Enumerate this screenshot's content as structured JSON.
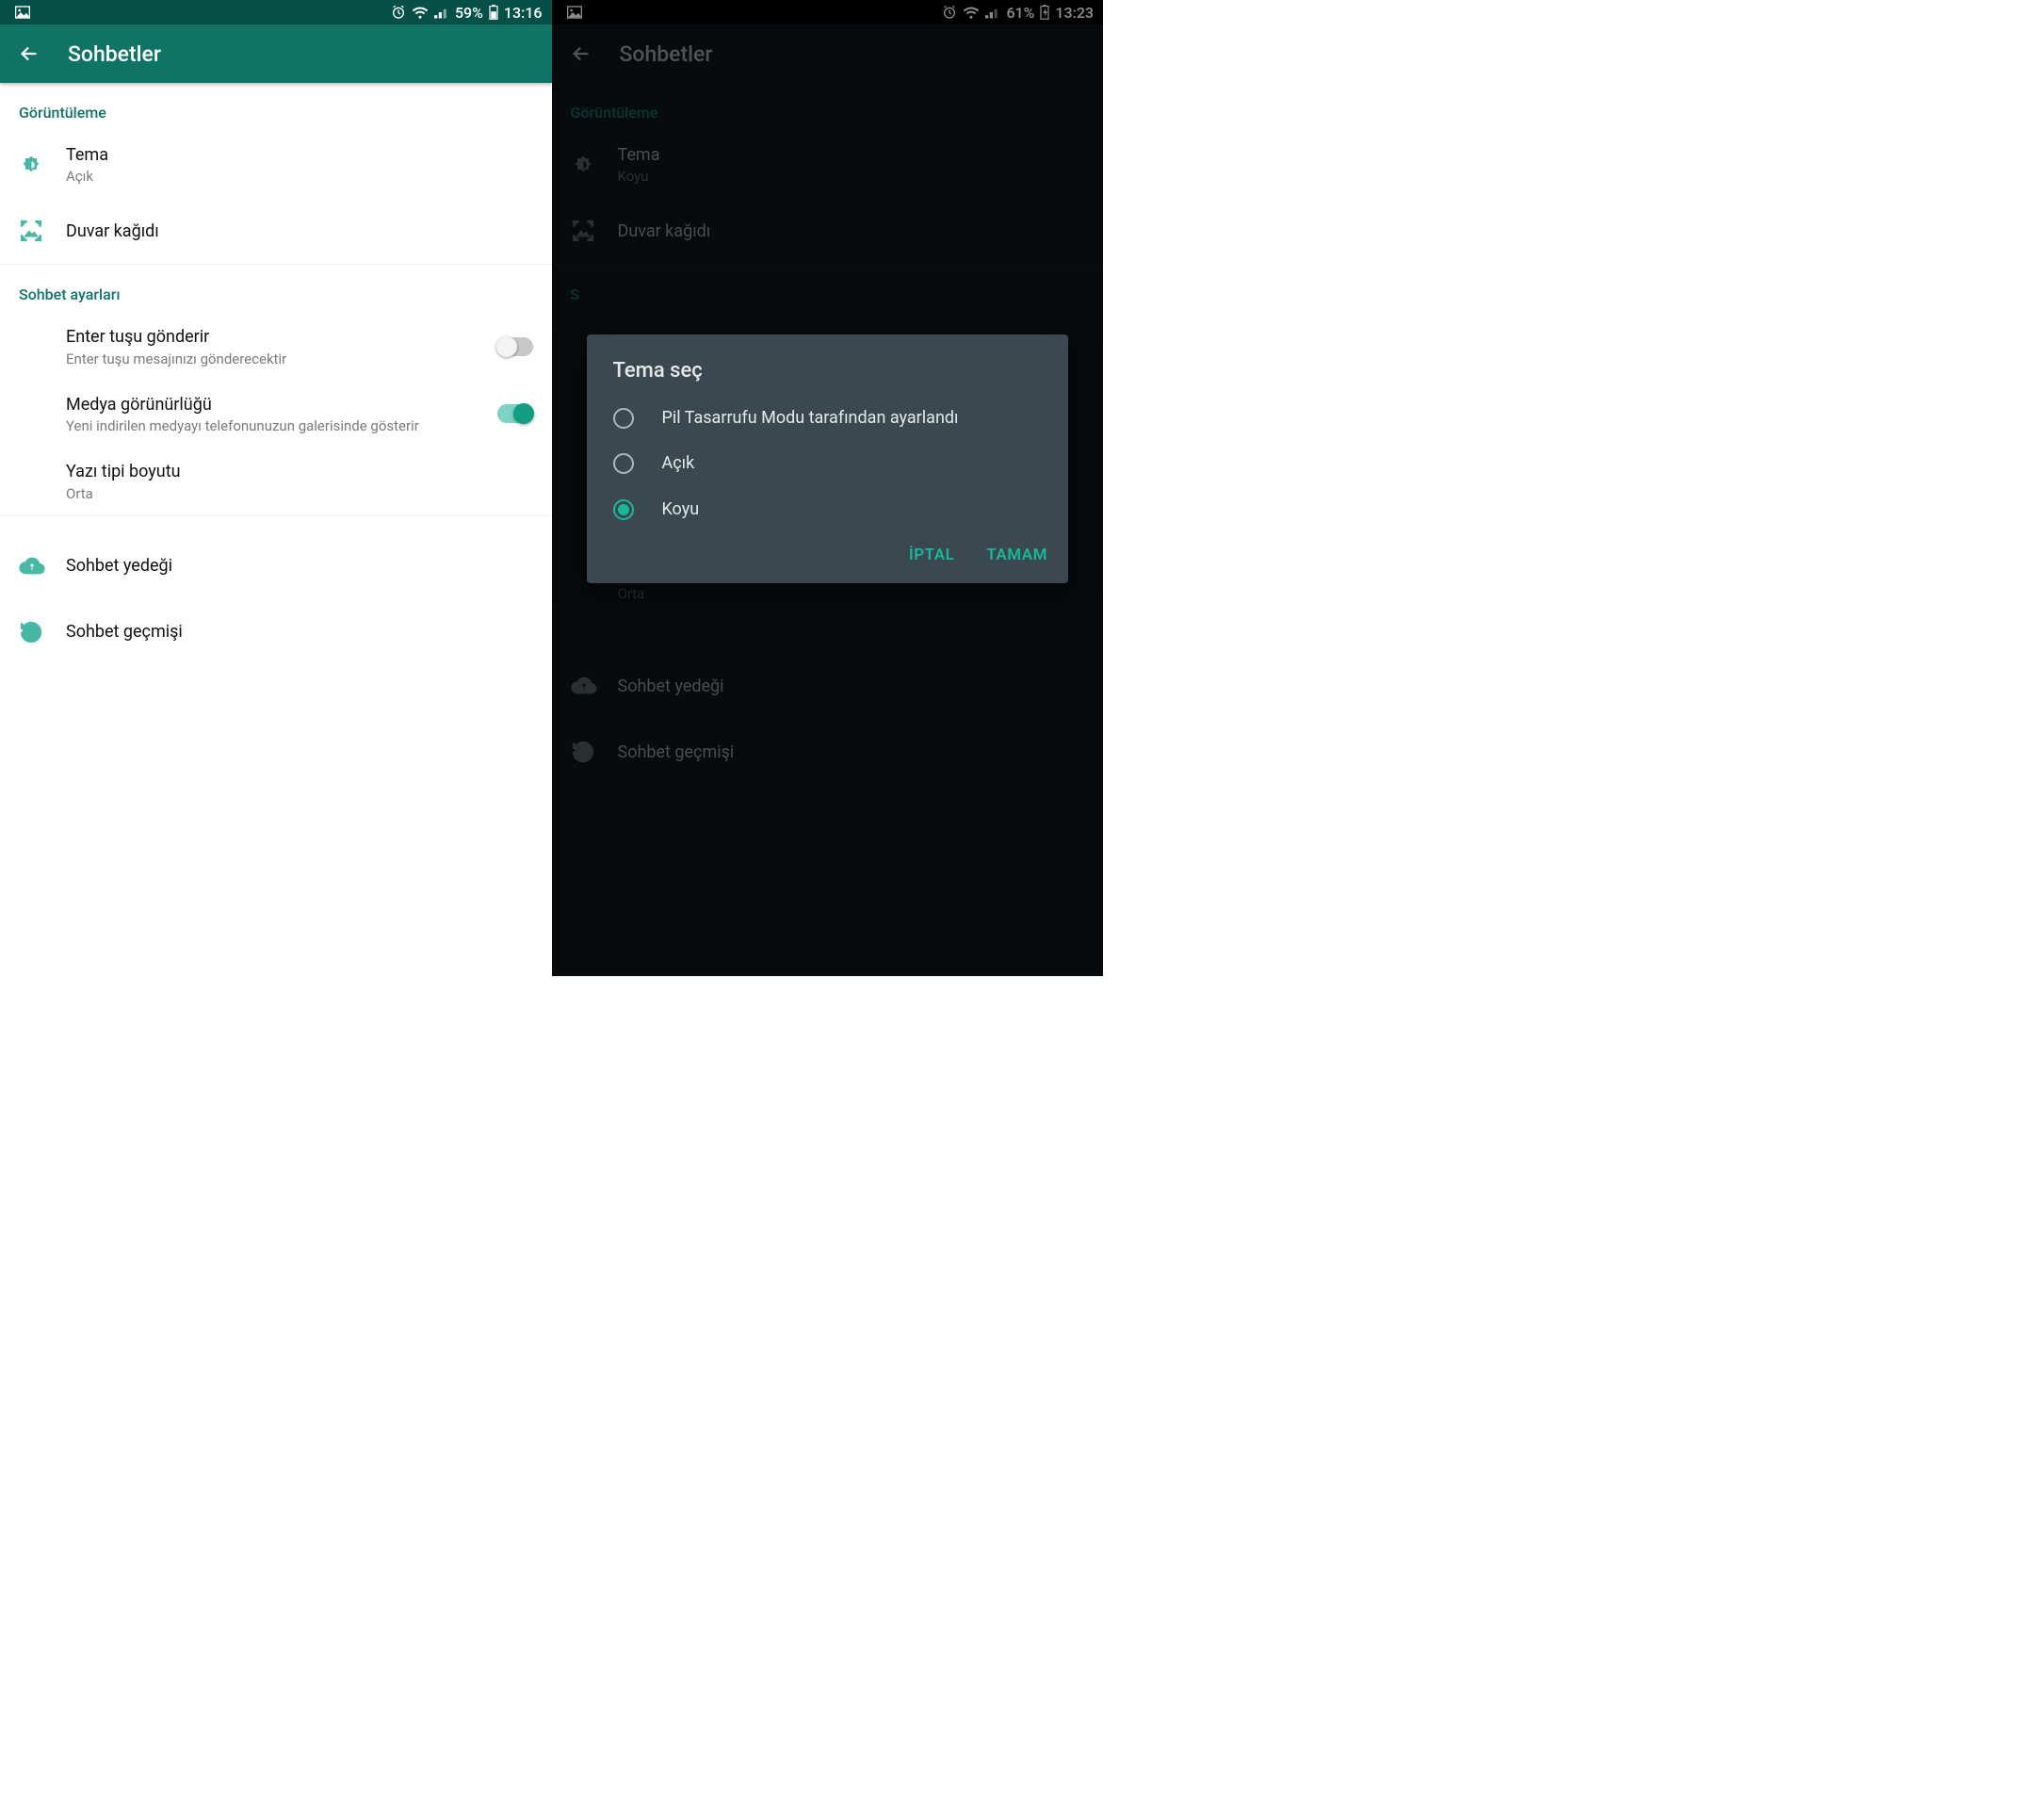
{
  "left": {
    "status": {
      "battery_pct": "59%",
      "time": "13:16"
    },
    "appbar": {
      "title": "Sohbetler"
    },
    "section_display": "Görüntüleme",
    "theme": {
      "title": "Tema",
      "value": "Açık"
    },
    "wallpaper": {
      "title": "Duvar kağıdı"
    },
    "section_chat": "Sohbet ayarları",
    "enter_send": {
      "title": "Enter tuşu gönderir",
      "sub": "Enter tuşu mesajınızı gönderecektir",
      "on": false
    },
    "media_vis": {
      "title": "Medya görünürlüğü",
      "sub": "Yeni indirilen medyayı telefonunuzun galerisinde gösterir",
      "on": true
    },
    "font_size": {
      "title": "Yazı tipi boyutu",
      "value": "Orta"
    },
    "backup": {
      "title": "Sohbet yedeği"
    },
    "history": {
      "title": "Sohbet geçmişi"
    }
  },
  "right": {
    "status": {
      "battery_pct": "61%",
      "time": "13:23"
    },
    "appbar": {
      "title": "Sohbetler"
    },
    "section_display": "Görüntüleme",
    "theme": {
      "title": "Tema",
      "value": "Koyu"
    },
    "wallpaper": {
      "title": "Duvar kağıdı"
    },
    "section_chat": "S",
    "font_size_value": "Orta",
    "backup": {
      "title": "Sohbet yedeği"
    },
    "history": {
      "title": "Sohbet geçmişi"
    },
    "dialog": {
      "title": "Tema seç",
      "options": [
        {
          "label": "Pil Tasarrufu Modu tarafından ayarlandı",
          "selected": false
        },
        {
          "label": "Açık",
          "selected": false
        },
        {
          "label": "Koyu",
          "selected": true
        }
      ],
      "cancel": "İPTAL",
      "ok": "TAMAM"
    }
  }
}
